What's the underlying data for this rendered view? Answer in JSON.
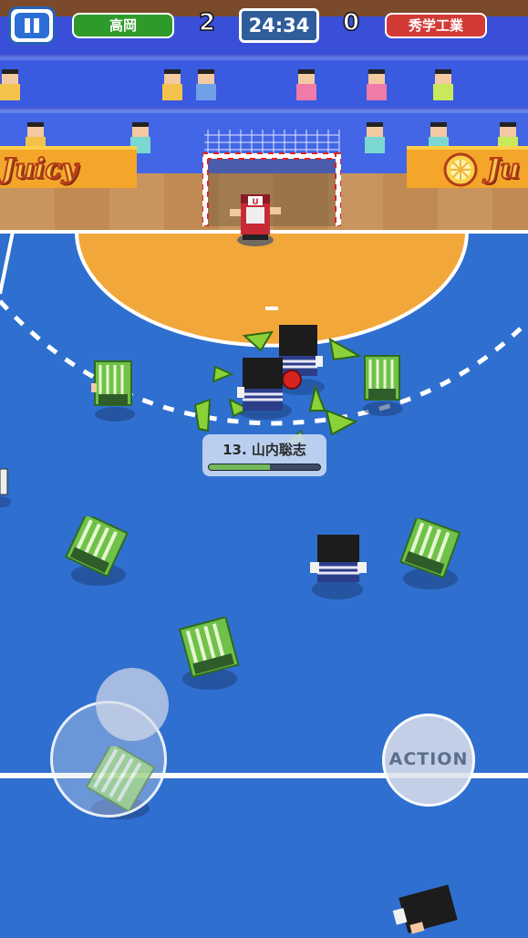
{
  "hud": {
    "home_team": "高岡",
    "home_score": "2",
    "timer": "24:34",
    "away_score": "0",
    "away_team": "秀学工業"
  },
  "player_tag": {
    "label": "13. 山内聡志",
    "stamina": 0.55
  },
  "controls": {
    "action_label": "ACTION"
  },
  "banners": {
    "left_text": "Juicy",
    "right_text": "Ju"
  },
  "colors": {
    "home_team": "#2e9a2a",
    "away_team": "#d23a36",
    "timer_bg": "#2f5d9c",
    "court": "#2f6fd0",
    "key_area": "#f2a73b",
    "selection_arrows": "#8bd23a"
  },
  "icons": {
    "pause": "pause-icon",
    "ball": "ball-icon"
  }
}
